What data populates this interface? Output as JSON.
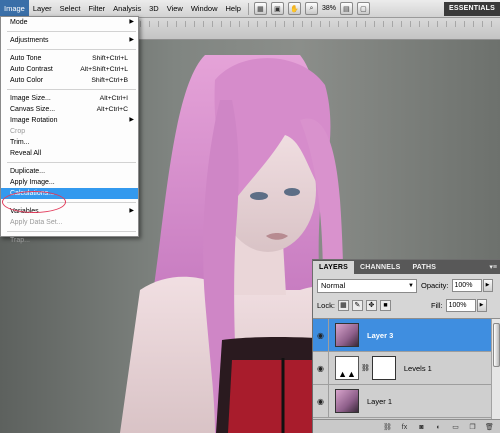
{
  "menubar": {
    "items": [
      "Image",
      "Layer",
      "Select",
      "Filter",
      "Analysis",
      "3D",
      "View",
      "Window",
      "Help"
    ],
    "zoom": "38%",
    "workspace": "ESSENTIALS",
    "accent": "#3a6fa8"
  },
  "image_menu": {
    "items": [
      {
        "label": "Mode",
        "shortcut": "",
        "submenu": true,
        "disabled": false
      },
      {
        "label": "Adjustments",
        "shortcut": "",
        "submenu": true,
        "disabled": false
      },
      {
        "label": "Auto Tone",
        "shortcut": "Shift+Ctrl+L",
        "submenu": false,
        "disabled": false
      },
      {
        "label": "Auto Contrast",
        "shortcut": "Alt+Shift+Ctrl+L",
        "submenu": false,
        "disabled": false
      },
      {
        "label": "Auto Color",
        "shortcut": "Shift+Ctrl+B",
        "submenu": false,
        "disabled": false
      },
      {
        "label": "Image Size...",
        "shortcut": "Alt+Ctrl+I",
        "submenu": false,
        "disabled": false
      },
      {
        "label": "Canvas Size...",
        "shortcut": "Alt+Ctrl+C",
        "submenu": false,
        "disabled": false
      },
      {
        "label": "Image Rotation",
        "shortcut": "",
        "submenu": true,
        "disabled": false
      },
      {
        "label": "Crop",
        "shortcut": "",
        "submenu": false,
        "disabled": true
      },
      {
        "label": "Trim...",
        "shortcut": "",
        "submenu": false,
        "disabled": false
      },
      {
        "label": "Reveal All",
        "shortcut": "",
        "submenu": false,
        "disabled": false
      },
      {
        "label": "Duplicate...",
        "shortcut": "",
        "submenu": false,
        "disabled": false
      },
      {
        "label": "Apply Image...",
        "shortcut": "",
        "submenu": false,
        "disabled": false
      },
      {
        "label": "Calculations...",
        "shortcut": "",
        "submenu": false,
        "disabled": false,
        "highlighted": true
      },
      {
        "label": "Variables",
        "shortcut": "",
        "submenu": true,
        "disabled": false
      },
      {
        "label": "Apply Data Set...",
        "shortcut": "",
        "submenu": false,
        "disabled": true
      },
      {
        "label": "Trap...",
        "shortcut": "",
        "submenu": false,
        "disabled": true
      }
    ],
    "highlight_color": "#3399ee",
    "annotation_color": "#e23a5a"
  },
  "layers_panel": {
    "tabs": [
      "LAYERS",
      "CHANNELS",
      "PATHS"
    ],
    "blend_mode": "Normal",
    "opacity_label": "Opacity:",
    "opacity": "100%",
    "lock_label": "Lock:",
    "fill_label": "Fill:",
    "fill": "100%",
    "layers": [
      {
        "name": "Layer 3",
        "selected": true
      },
      {
        "name": "Levels 1",
        "selected": false
      },
      {
        "name": "Layer 1",
        "selected": false
      }
    ],
    "selection_color": "#3f8ee0"
  }
}
